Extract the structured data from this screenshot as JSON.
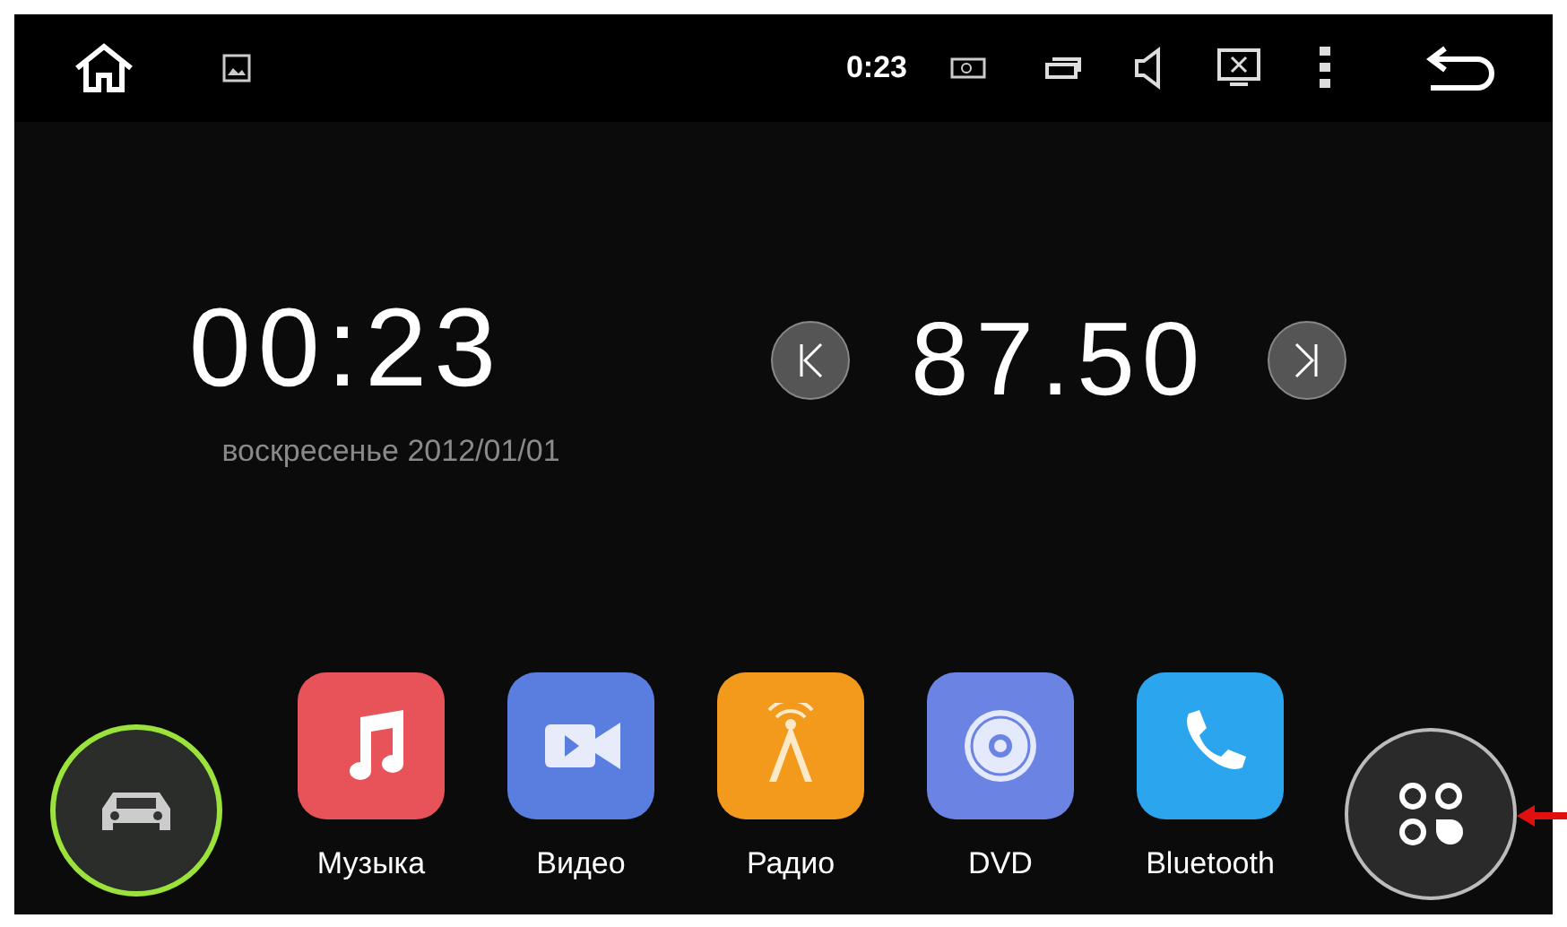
{
  "status_bar": {
    "time": "0:23"
  },
  "clock": {
    "time": "00:23",
    "date": "воскресенье 2012/01/01"
  },
  "radio": {
    "frequency": "87.50"
  },
  "dock": [
    {
      "label": "Музыка",
      "kind": "music"
    },
    {
      "label": "Видео",
      "kind": "video"
    },
    {
      "label": "Радио",
      "kind": "radio"
    },
    {
      "label": "DVD",
      "kind": "dvd"
    },
    {
      "label": "Bluetooth",
      "kind": "phone"
    }
  ]
}
